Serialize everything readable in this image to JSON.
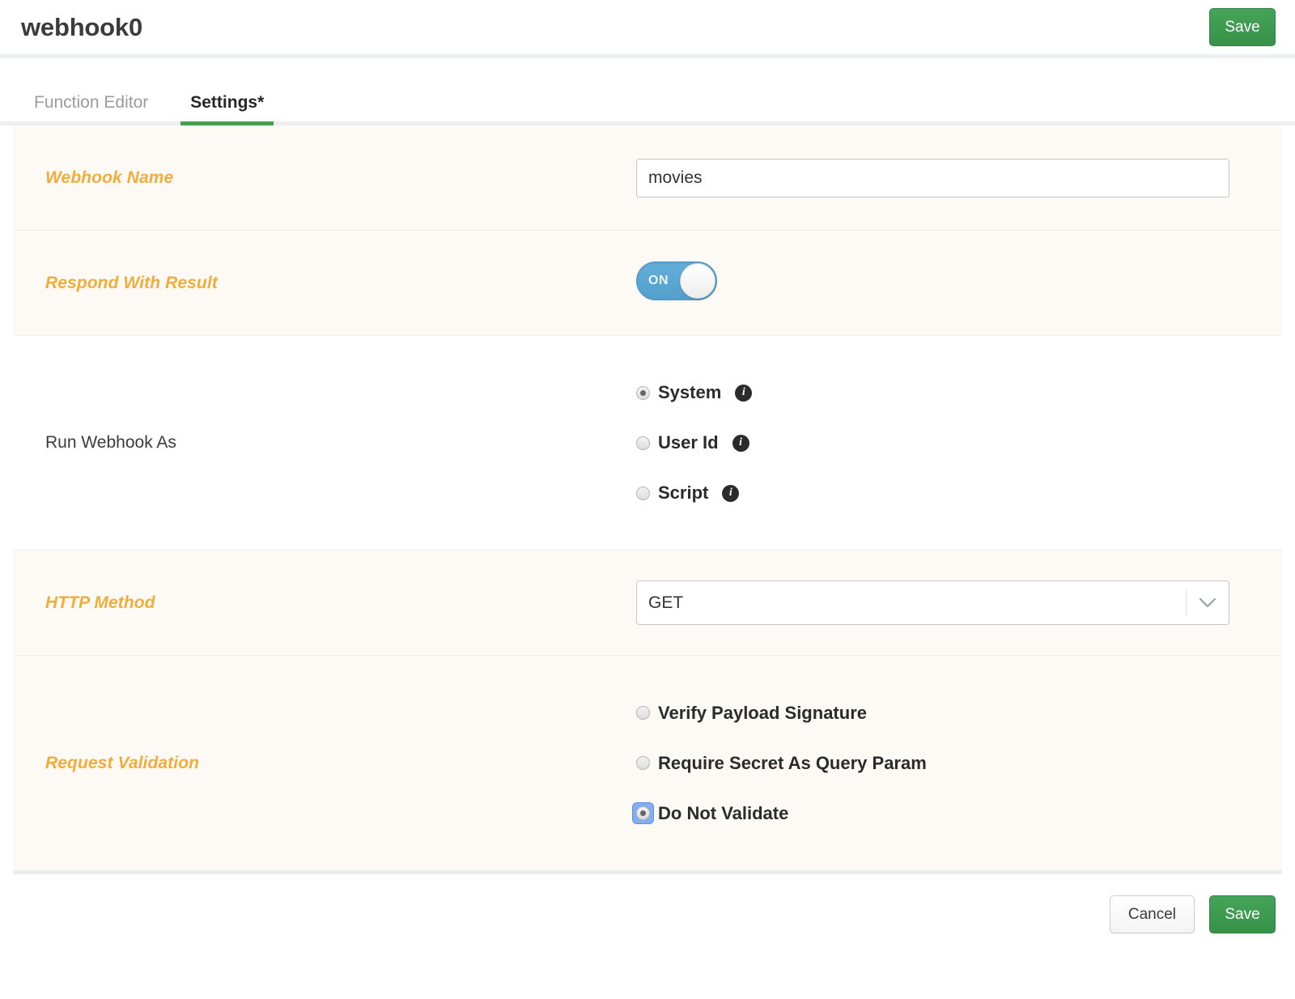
{
  "header": {
    "title": "webhook0",
    "save_label": "Save"
  },
  "tabs": [
    {
      "label": "Function Editor",
      "active": false
    },
    {
      "label": "Settings*",
      "active": true
    }
  ],
  "settings": {
    "webhook_name": {
      "label": "Webhook Name",
      "value": "movies",
      "placeholder": ""
    },
    "respond_with_result": {
      "label": "Respond With Result",
      "state": "ON"
    },
    "run_webhook_as": {
      "label": "Run Webhook As",
      "options": [
        {
          "label": "System",
          "selected": true,
          "info": "info-icon"
        },
        {
          "label": "User Id",
          "selected": false,
          "info": "info-icon"
        },
        {
          "label": "Script",
          "selected": false,
          "info": "info-icon"
        }
      ]
    },
    "http_method": {
      "label": "HTTP Method",
      "value": "GET"
    },
    "request_validation": {
      "label": "Request Validation",
      "options": [
        {
          "label": "Verify Payload Signature",
          "selected": false,
          "focused": false
        },
        {
          "label": "Require Secret As Query Param",
          "selected": false,
          "focused": false
        },
        {
          "label": "Do Not Validate",
          "selected": true,
          "focused": true
        }
      ]
    }
  },
  "footer": {
    "cancel_label": "Cancel",
    "save_label": "Save"
  },
  "colors": {
    "accent_green": "#3d9c50",
    "label_orange": "#f0ad3c",
    "toggle_blue": "#5ba7d4",
    "panel_cream": "#fdfaf5",
    "divider_gray": "#eceef0",
    "focus_blue": "#84aef0"
  }
}
